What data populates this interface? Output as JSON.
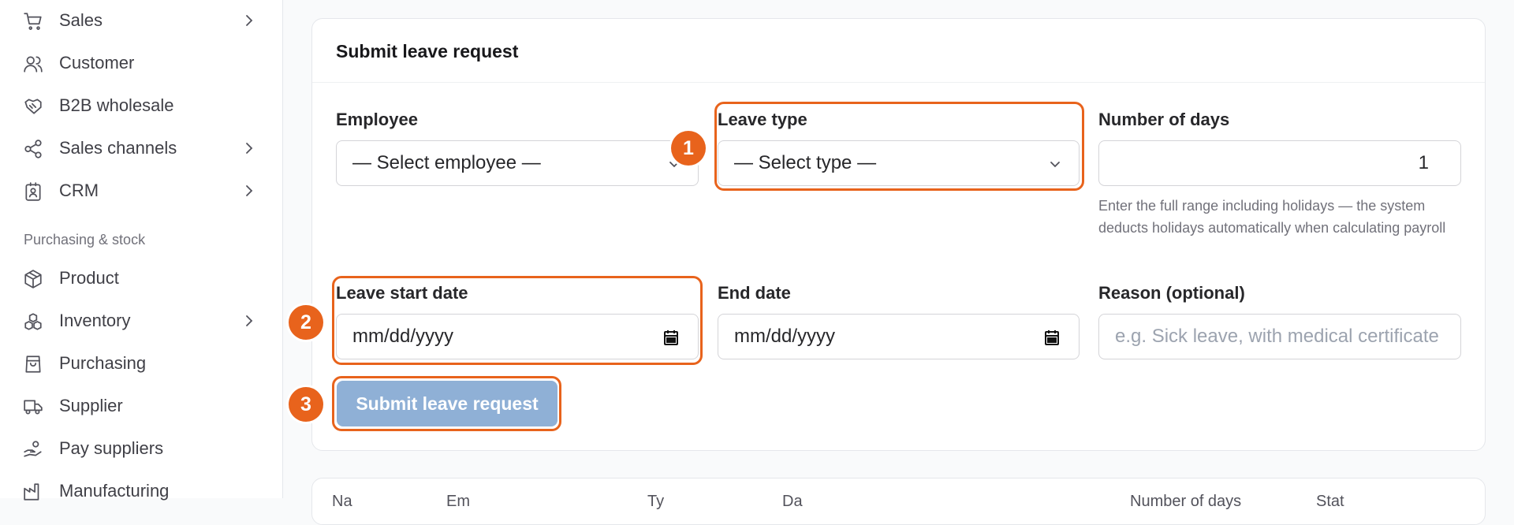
{
  "sidebar": {
    "items_top": [
      {
        "label": "Sales",
        "icon": "shopping-cart-icon",
        "has_chevron": true
      },
      {
        "label": "Customer",
        "icon": "users-icon",
        "has_chevron": false
      },
      {
        "label": "B2B wholesale",
        "icon": "handshake-icon",
        "has_chevron": false
      },
      {
        "label": "Sales channels",
        "icon": "share-icon",
        "has_chevron": true
      },
      {
        "label": "CRM",
        "icon": "contact-card-icon",
        "has_chevron": true
      }
    ],
    "section_title": "Purchasing & stock",
    "items_bottom": [
      {
        "label": "Product",
        "icon": "box-icon",
        "has_chevron": false
      },
      {
        "label": "Inventory",
        "icon": "boxes-icon",
        "has_chevron": true
      },
      {
        "label": "Purchasing",
        "icon": "shopping-bag-icon",
        "has_chevron": false
      },
      {
        "label": "Supplier",
        "icon": "truck-icon",
        "has_chevron": false
      },
      {
        "label": "Pay suppliers",
        "icon": "hand-coins-icon",
        "has_chevron": false
      },
      {
        "label": "Manufacturing",
        "icon": "factory-icon",
        "has_chevron": false
      }
    ]
  },
  "form": {
    "title": "Submit leave request",
    "employee": {
      "label": "Employee",
      "value": "— Select employee —"
    },
    "leave_type": {
      "label": "Leave type",
      "value": "— Select type —"
    },
    "days": {
      "label": "Number of days",
      "value": "1",
      "help": "Enter the full range including holidays — the system deducts holidays automatically when calculating payroll"
    },
    "start_date": {
      "label": "Leave start date",
      "value": "mm/dd/yyyy"
    },
    "end_date": {
      "label": "End date",
      "value": "mm/dd/yyyy"
    },
    "reason": {
      "label": "Reason (optional)",
      "placeholder": "e.g. Sick leave, with medical certificate"
    },
    "submit_label": "Submit leave request"
  },
  "annotations": {
    "one": "1",
    "two": "2",
    "three": "3",
    "color": "#e8631c"
  },
  "table": {
    "headers": [
      "Na",
      "Em",
      "Ty",
      "Da",
      "Number of days",
      "Stat"
    ]
  },
  "colors": {
    "accent": "#e8631c",
    "button": "#8fb0d6"
  }
}
